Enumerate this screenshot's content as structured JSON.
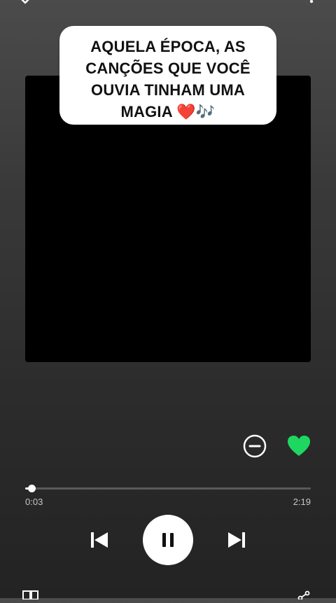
{
  "caption": {
    "text": "AQUELA ÉPOCA, AS CANÇÕES QUE VOCÊ OUVIA TINHAM UMA MAGIA ❤️🎶"
  },
  "player": {
    "elapsed": "0:03",
    "duration": "2:19",
    "progress_fraction": 0.023,
    "state": "playing",
    "liked": true
  },
  "colors": {
    "accent": "#1ed760",
    "background_top": "#4b4b4b",
    "background_bottom": "#232323",
    "caption_bg": "#ffffff"
  },
  "icons": {
    "top_left": "chevron-down-icon",
    "top_right": "more-options-icon",
    "exclude": "minus-circle-icon",
    "like": "heart-icon",
    "previous": "skip-previous-icon",
    "play_pause": "pause-icon",
    "next": "skip-next-icon",
    "devices": "devices-icon",
    "share": "share-icon"
  }
}
